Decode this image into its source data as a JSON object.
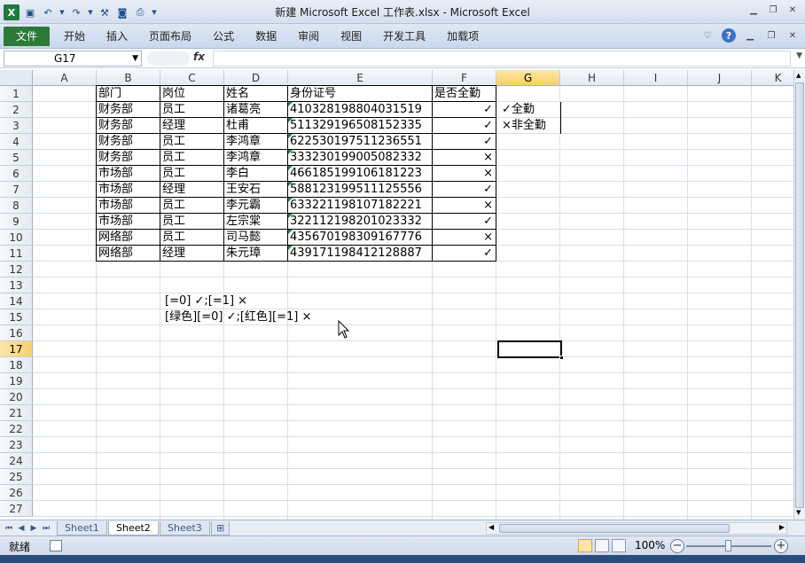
{
  "window": {
    "title": "新建 Microsoft Excel 工作表.xlsx - Microsoft Excel",
    "app_icon": "X"
  },
  "ribbon": {
    "tabs": [
      "文件",
      "开始",
      "插入",
      "页面布局",
      "公式",
      "数据",
      "审阅",
      "视图",
      "开发工具",
      "加载项"
    ]
  },
  "formula_bar": {
    "name_box": "G17",
    "fx_label": "fx",
    "formula": ""
  },
  "columns": [
    "A",
    "B",
    "C",
    "D",
    "E",
    "F",
    "G",
    "H",
    "I",
    "J",
    "K"
  ],
  "selected_column": "G",
  "selected_row": "17",
  "rows": [
    "1",
    "2",
    "3",
    "4",
    "5",
    "6",
    "7",
    "8",
    "9",
    "10",
    "11",
    "12",
    "13",
    "14",
    "15",
    "16",
    "17",
    "18",
    "19",
    "20",
    "21",
    "22",
    "23",
    "24",
    "25",
    "26",
    "27"
  ],
  "table": {
    "headers": [
      "部门",
      "岗位",
      "姓名",
      "身份证号",
      "是否全勤"
    ],
    "rows": [
      [
        "财务部",
        "员工",
        "诸葛亮",
        "410328198804031519",
        "✓"
      ],
      [
        "财务部",
        "经理",
        "杜甫",
        "511329196508152335",
        "✓"
      ],
      [
        "财务部",
        "员工",
        "李鸿章",
        "622530197511236551",
        "✓"
      ],
      [
        "财务部",
        "员工",
        "李鸿章",
        "333230199005082332",
        "×"
      ],
      [
        "市场部",
        "员工",
        "李白",
        "466185199106181223",
        "×"
      ],
      [
        "市场部",
        "经理",
        "王安石",
        "588123199511125556",
        "✓"
      ],
      [
        "市场部",
        "员工",
        "李元霸",
        "633221198107182221",
        "×"
      ],
      [
        "市场部",
        "员工",
        "左宗棠",
        "322112198201023332",
        "✓"
      ],
      [
        "网络部",
        "员工",
        "司马懿",
        "435670198309167776",
        "×"
      ],
      [
        "网络部",
        "经理",
        "朱元璋",
        "439171198412128887",
        "✓"
      ]
    ]
  },
  "legend": {
    "g2": "✓全勤",
    "g3": "×非全勤"
  },
  "notes": {
    "c14": "[=0] ✓;[=1] ×",
    "c15": "[绿色][=0] ✓;[红色][=1] ×"
  },
  "sheets": [
    "Sheet1",
    "Sheet2",
    "Sheet3"
  ],
  "active_sheet": "Sheet2",
  "status": {
    "mode": "就绪",
    "zoom": "100%"
  },
  "colors": {
    "file_tab": "#2d7a38",
    "selection_header": "#f9cf6c",
    "text_marker": "#1e8a3a"
  }
}
